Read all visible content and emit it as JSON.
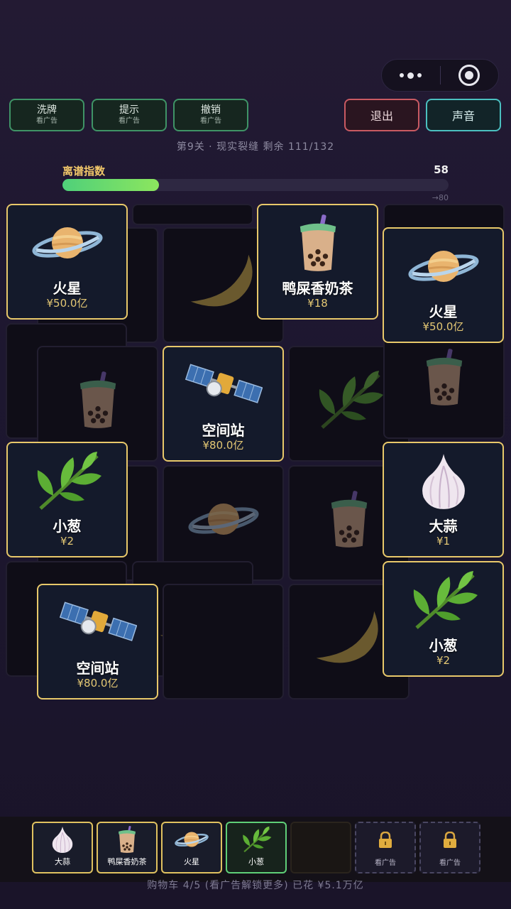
{
  "toolbar": {
    "tools": [
      {
        "label": "洗牌",
        "sub": "看广告"
      },
      {
        "label": "提示",
        "sub": "看广告"
      },
      {
        "label": "撤销",
        "sub": "看广告"
      }
    ],
    "exit_label": "退出",
    "sound_label": "声音"
  },
  "level": {
    "text": "第9关 · 现实裂缝  剩余 111/132"
  },
  "meter": {
    "label": "离谱指数",
    "value": "58",
    "goal": "→80",
    "fill_fraction": 0.25,
    "fill_color": "#6bdc6a"
  },
  "cards": {
    "c1": {
      "name": "火星",
      "price": "¥50.0亿",
      "icon": "planet-icon"
    },
    "c2": {
      "name": "鸭屎香奶茶",
      "price": "¥18",
      "icon": "bubble-tea-icon"
    },
    "c3": {
      "name": "火星",
      "price": "¥50.0亿",
      "icon": "planet-icon"
    },
    "c4": {
      "name": "空间站",
      "price": "¥80.0亿",
      "icon": "satellite-icon"
    },
    "c5": {
      "name": "小葱",
      "price": "¥2",
      "icon": "herb-icon"
    },
    "c6": {
      "name": "大蒜",
      "price": "¥1",
      "icon": "garlic-icon"
    },
    "c7": {
      "name": "小葱",
      "price": "¥2",
      "icon": "herb-icon"
    },
    "c8": {
      "name": "空间站",
      "price": "¥80.0亿",
      "icon": "satellite-icon"
    }
  },
  "cart": {
    "slots": [
      {
        "label": "大蒜",
        "icon": "garlic-icon"
      },
      {
        "label": "鸭屎香奶茶",
        "icon": "bubble-tea-icon"
      },
      {
        "label": "火星",
        "icon": "planet-icon"
      },
      {
        "label": "小葱",
        "icon": "herb-icon"
      }
    ],
    "locked_label": "看广告",
    "info": "购物车 4/5  (看广告解锁更多)  已花 ¥5.1万亿"
  },
  "colors": {
    "card_border": "#e8c86a",
    "price": "#e4c874",
    "exit_border": "#c95a62",
    "sound_border": "#4bc0c0",
    "tool_border": "#3f9466"
  }
}
